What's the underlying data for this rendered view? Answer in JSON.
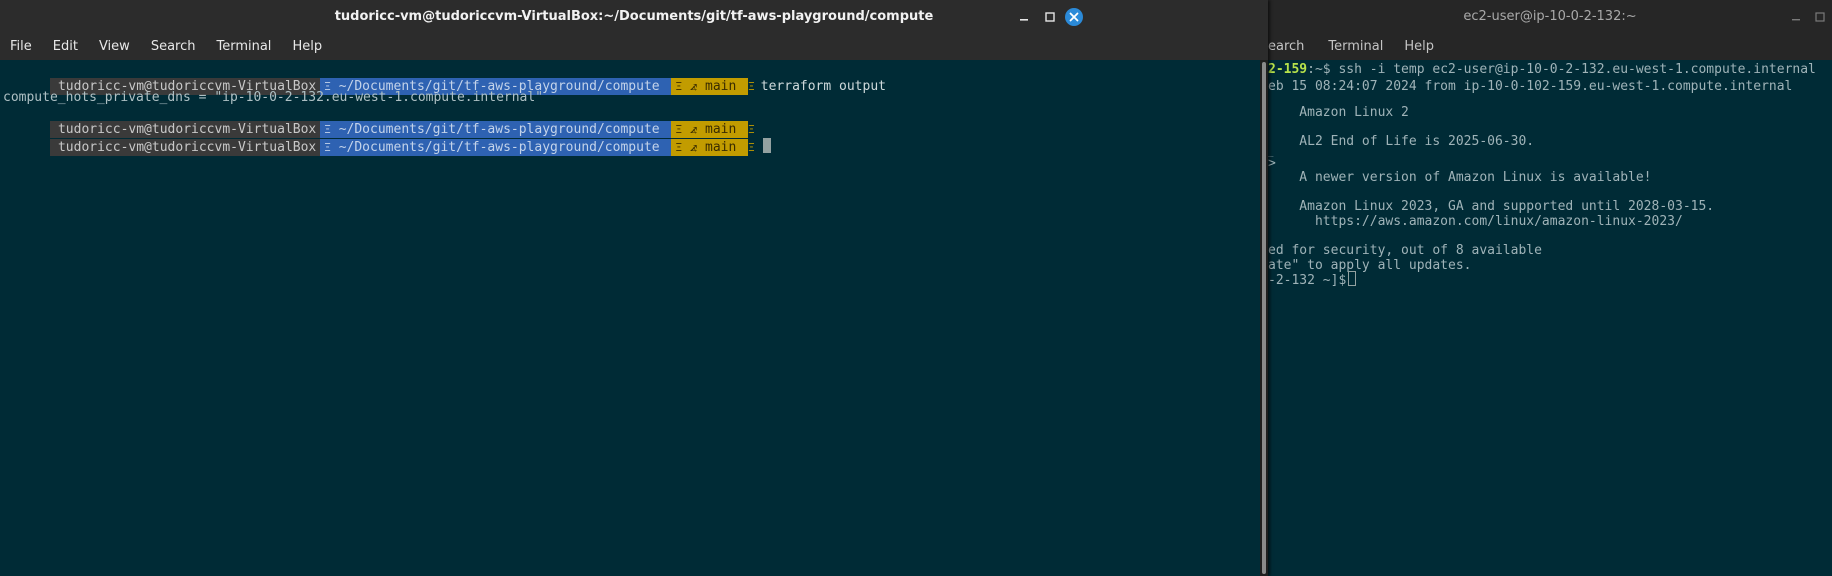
{
  "left_window": {
    "title": "tudoricc-vm@tudoriccvm-VirtualBox:~/Documents/git/tf-aws-playground/compute",
    "menu": [
      "File",
      "Edit",
      "View",
      "Search",
      "Terminal",
      "Help"
    ],
    "prompt": {
      "user_host": "tudoricc-vm@tudoriccvm-VirtualBox",
      "path": "~/Documents/git/tf-aws-playground/compute",
      "branch_icon": "⦨",
      "branch": "main",
      "separator": "Ξ"
    },
    "command": "terraform output",
    "output_line": "compute_hots_private_dns = \"ip-10-0-2-132.eu-west-1.compute.internal\""
  },
  "right_window": {
    "title": "ec2-user@ip-10-0-2-132:~",
    "menu": [
      "earch",
      "Terminal",
      "Help"
    ],
    "lines": {
      "prompt_host": "2-159",
      "prompt_cmd": ":~$ ssh -i temp ec2-user@ip-10-0-2-132.eu-west-1.compute.internal",
      "last_login": "eb 15 08:24:07 2024 from ip-10-0-102-159.eu-west-1.compute.internal",
      "amazon_linux_2": "    Amazon Linux 2",
      "eol": "    AL2 End of Life is 2025-06-30.",
      "tick": "_",
      "arrow": ">",
      "newer_version": "    A newer version of Amazon Linux is available!",
      "al2023": "    Amazon Linux 2023, GA and supported until 2028-03-15.",
      "al2023_url": "      https://aws.amazon.com/linux/amazon-linux-2023/",
      "security": "ed for security, out of 8 available",
      "apply": "ate\" to apply all updates.",
      "final_prompt": "-2-132 ~]$"
    }
  },
  "colors": {
    "terminal_bg": "#002b36",
    "prompt_user_bg": "#3a3a3a",
    "prompt_path_bg": "#2e62b2",
    "prompt_git_bg": "#c29c00",
    "close_button": "#2b8ad8"
  },
  "icons": {
    "minimize": "minimize-icon",
    "maximize": "maximize-icon",
    "close": "close-icon"
  }
}
